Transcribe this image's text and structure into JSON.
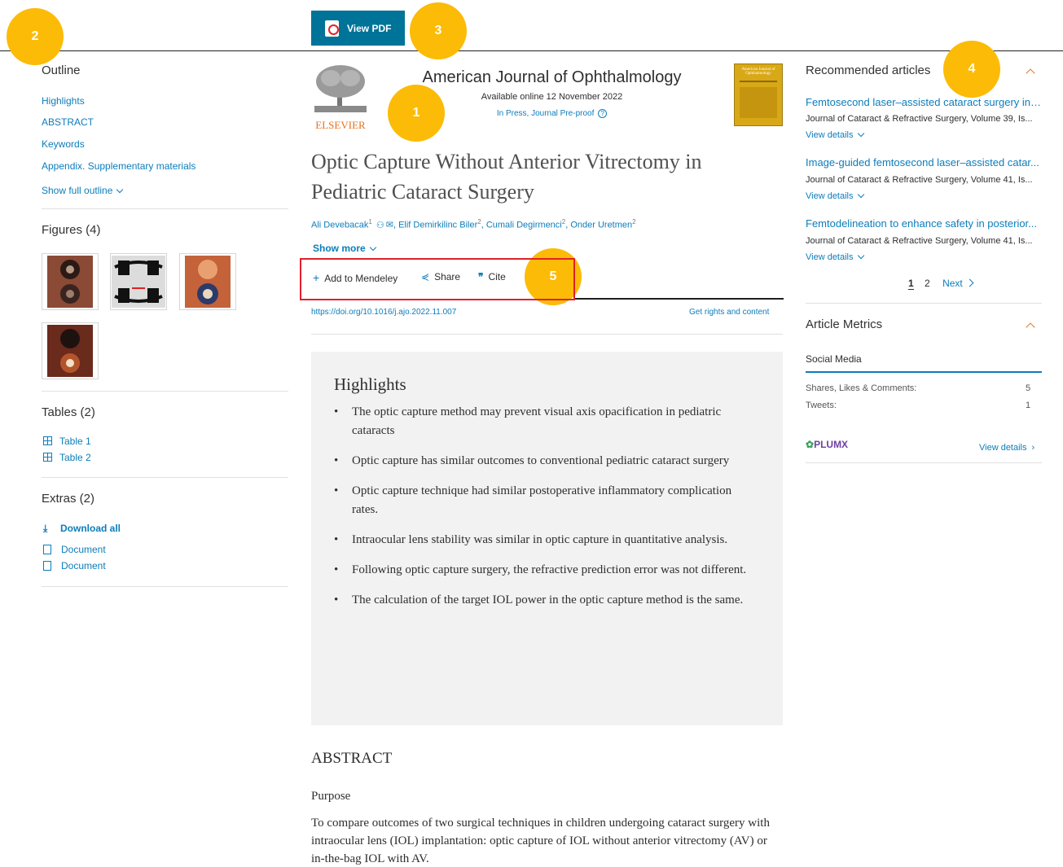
{
  "header": {
    "view_pdf_label": "View PDF"
  },
  "badges": [
    "1",
    "2",
    "3",
    "4",
    "5"
  ],
  "colors": {
    "accent": "#0c7dbb",
    "pdf_button": "#007398",
    "badge": "#fcbb06",
    "highlight_box": "#e0202a",
    "orange": "#e9711c"
  },
  "outline": {
    "title": "Outline",
    "links": [
      "Highlights",
      "ABSTRACT",
      "Keywords",
      "Appendix. Supplementary materials"
    ],
    "show_full": "Show full outline"
  },
  "figures": {
    "title": "Figures (4)"
  },
  "tables": {
    "title": "Tables (2)",
    "items": [
      "Table 1",
      "Table 2"
    ]
  },
  "extras": {
    "title": "Extras (2)",
    "download_all": "Download all",
    "items": [
      "Document",
      "Document"
    ]
  },
  "journal": {
    "publisher": "ELSEVIER",
    "name": "American Journal of Ophthalmology",
    "available": "Available online 12 November 2022",
    "status": "In Press, Journal Pre-proof",
    "cover_title": "American Journal of Ophthalmology"
  },
  "article": {
    "title": "Optic Capture Without Anterior Vitrectomy in Pediatric Cataract Surgery",
    "authors": [
      {
        "name": "Ali Devebacak",
        "sup": "1"
      },
      {
        "name": "Elif Demirkilinc Biler",
        "sup": "2"
      },
      {
        "name": "Cumali Degirmenci",
        "sup": "2"
      },
      {
        "name": "Onder Uretmen",
        "sup": "2"
      }
    ],
    "show_more": "Show more",
    "doi": "https://doi.org/10.1016/j.ajo.2022.11.007",
    "rights": "Get rights and content"
  },
  "toolbar": {
    "mendeley": "Add to Mendeley",
    "share": "Share",
    "cite": "Cite"
  },
  "highlights": {
    "title": "Highlights",
    "items": [
      "The optic capture method may prevent visual axis opacification in pediatric cataracts",
      "Optic capture has similar outcomes to conventional pediatric cataract surgery",
      "Optic capture technique had similar postoperative inflammatory complication rates.",
      "Intraocular lens stability was similar in optic capture in quantitative analysis.",
      "Following optic capture surgery, the refractive prediction error was not different.",
      "The calculation of the target IOL power in the optic capture method is the same."
    ]
  },
  "abstract": {
    "title": "ABSTRACT",
    "purpose_label": "Purpose",
    "purpose_text": "To compare outcomes of two surgical techniques in children undergoing cataract surgery with intraocular lens (IOL) implantation: optic capture of IOL without anterior vitrectomy (AV) or in-the-bag IOL with AV."
  },
  "recommended": {
    "title": "Recommended articles",
    "items": [
      {
        "title": "Femtosecond laser–assisted cataract surgery in ...",
        "source": "Journal of Cataract & Refractive Surgery, Volume 39, Is...",
        "view": "View details"
      },
      {
        "title": "Image-guided femtosecond laser–assisted catar...",
        "source": "Journal of Cataract & Refractive Surgery, Volume 41, Is...",
        "view": "View details"
      },
      {
        "title": "Femtodelineation to enhance safety in posterior...",
        "source": "Journal of Cataract & Refractive Surgery, Volume 41, Is...",
        "view": "View details"
      }
    ],
    "pages": [
      "1",
      "2"
    ],
    "next": "Next"
  },
  "metrics": {
    "title": "Article Metrics",
    "social": "Social Media",
    "rows": [
      {
        "label": "Shares, Likes & Comments:",
        "value": "5"
      },
      {
        "label": "Tweets:",
        "value": "1"
      }
    ],
    "plumx": "PLUMX",
    "view_details": "View details"
  }
}
